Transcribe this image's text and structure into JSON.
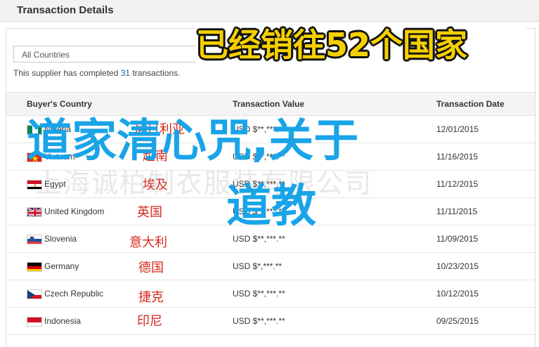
{
  "header": {
    "title": "Transaction Details"
  },
  "filter": {
    "selected": "All Countries"
  },
  "summary": {
    "prefix": "This supplier has completed ",
    "count": "31",
    "suffix": " transactions."
  },
  "table": {
    "columns": [
      "Buyer's Country",
      "Transaction Value",
      "Transaction Date"
    ],
    "rows": [
      {
        "country": "Nigeria",
        "value": "USD $**,***.**",
        "date": "12/01/2015",
        "label_cn": "尼日利亚",
        "flag": "flag-nigeria-icon"
      },
      {
        "country": "Vietnam",
        "value": "USD $**,***.**",
        "date": "11/16/2015",
        "label_cn": "越南",
        "flag": "flag-vietnam-icon"
      },
      {
        "country": "Egypt",
        "value": "USD $**,***.**",
        "date": "11/12/2015",
        "label_cn": "埃及",
        "flag": "flag-egypt-icon"
      },
      {
        "country": "United Kingdom",
        "value": "USD $**,***.**",
        "date": "11/11/2015",
        "label_cn": "英国",
        "flag": "flag-uk-icon"
      },
      {
        "country": "Slovenia",
        "value": "USD $**,***.**",
        "date": "11/09/2015",
        "label_cn": "意大利",
        "flag": "flag-slovenia-icon"
      },
      {
        "country": "Germany",
        "value": "USD $*,***.**",
        "date": "10/23/2015",
        "label_cn": "德国",
        "flag": "flag-germany-icon"
      },
      {
        "country": "Czech Republic",
        "value": "USD $**,***.**",
        "date": "10/12/2015",
        "label_cn": "捷克",
        "flag": "flag-czech-icon"
      },
      {
        "country": "Indonesia",
        "value": "USD $**,***.**",
        "date": "09/25/2015",
        "label_cn": "印尼",
        "flag": "flag-indonesia-icon"
      }
    ]
  },
  "banner": {
    "text": "已经销往52个国家"
  },
  "overlay": {
    "line1": "道家清心咒,关于",
    "line2": "道教"
  },
  "watermark": {
    "text": "上海诚柏制衣服装有限公司"
  },
  "colors": {
    "overlay": "#1aa4e8",
    "banner": "#f5d000",
    "cn_label": "#d62a1e",
    "count_link": "#1a5fb4"
  }
}
